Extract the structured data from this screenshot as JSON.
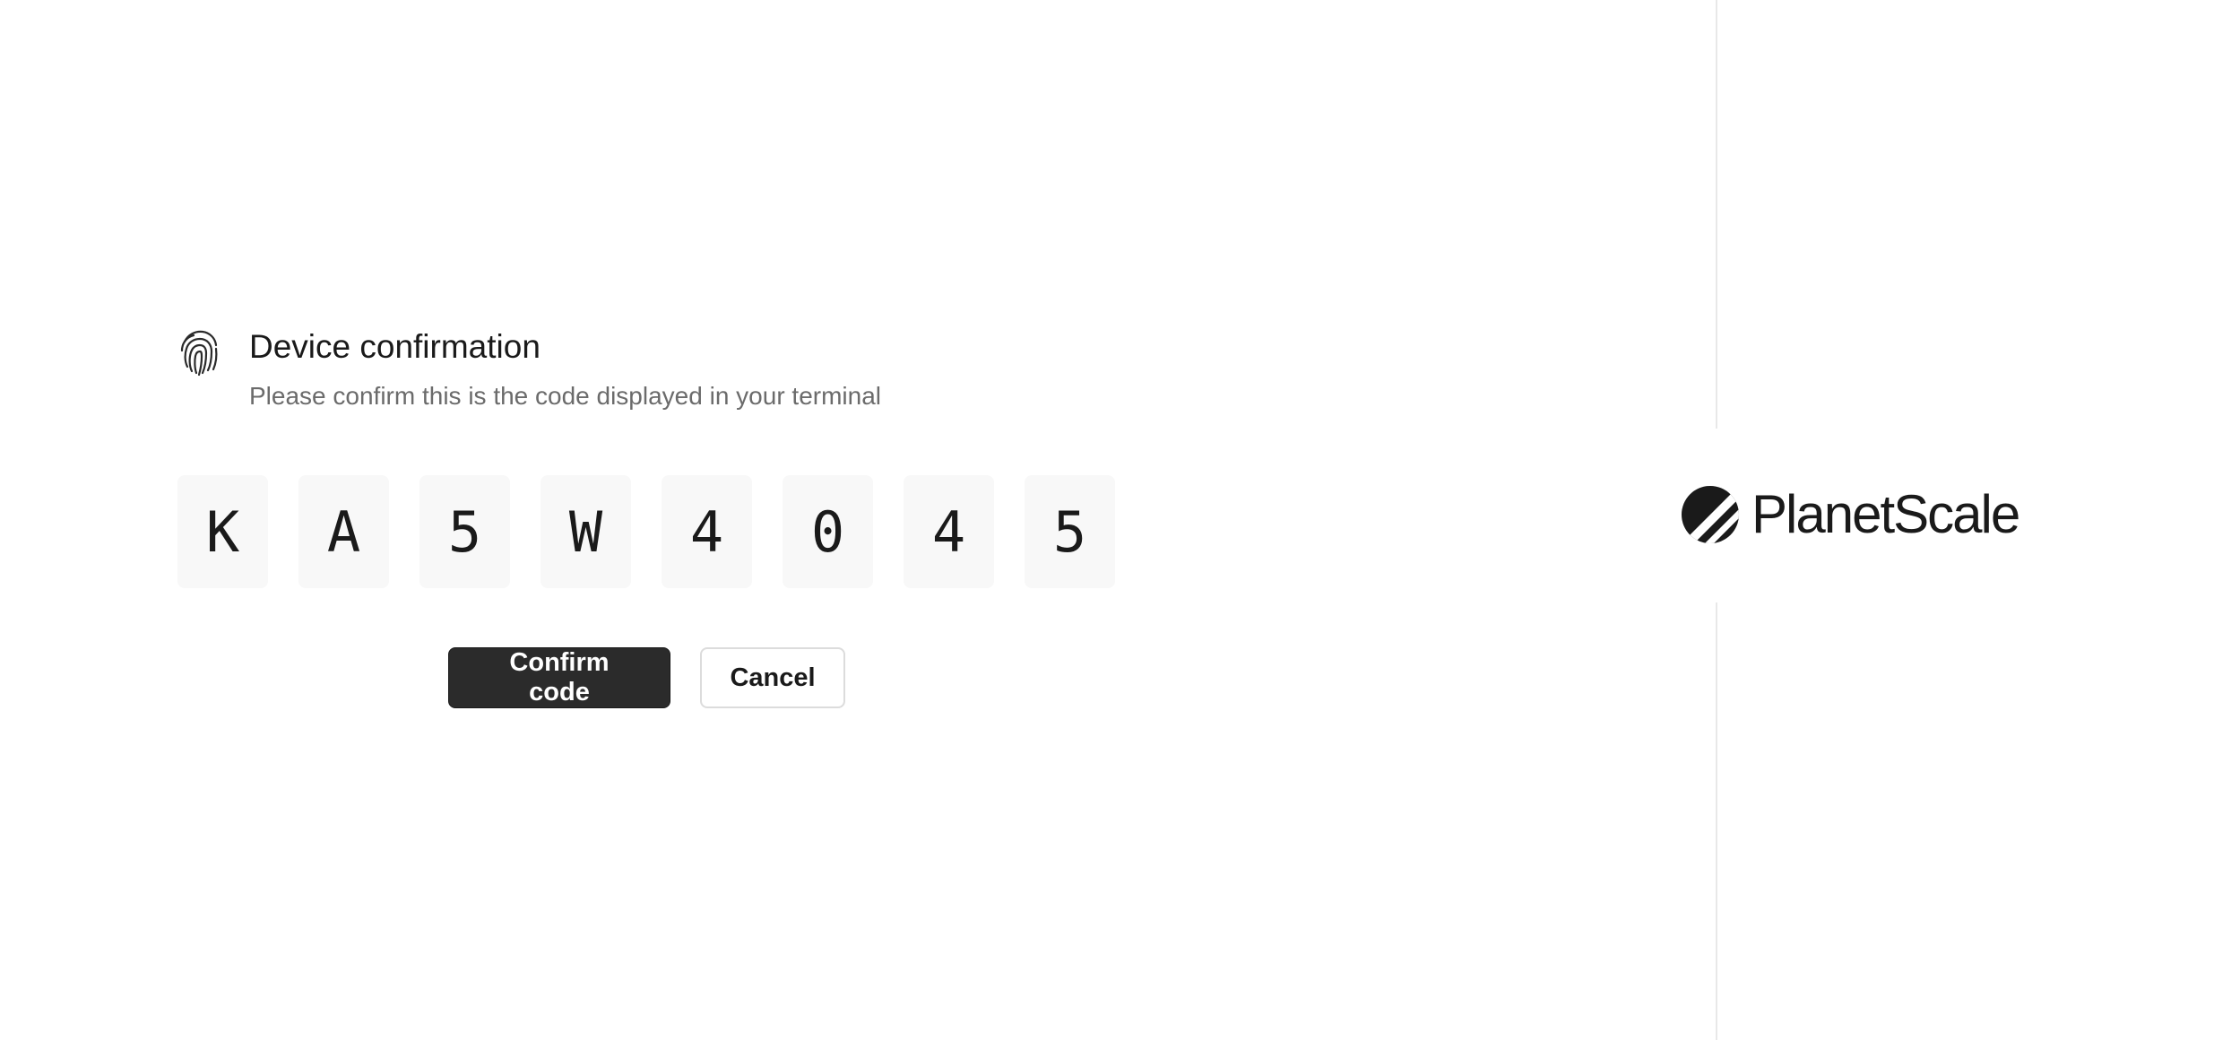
{
  "header": {
    "title": "Device confirmation",
    "subtitle": "Please confirm this is the code displayed in your terminal",
    "icon": "fingerprint-icon"
  },
  "code": [
    "K",
    "A",
    "5",
    "W",
    "4",
    "0",
    "4",
    "5"
  ],
  "actions": {
    "confirm_label": "Confirm code",
    "cancel_label": "Cancel"
  },
  "brand": {
    "name": "PlanetScale",
    "icon": "planetscale-logo-icon"
  },
  "colors": {
    "primary_button": "#2b2b2b",
    "code_cell_bg": "#f8f8f8",
    "subtitle_text": "#6b6b6b",
    "divider": "#e8e8e8"
  }
}
